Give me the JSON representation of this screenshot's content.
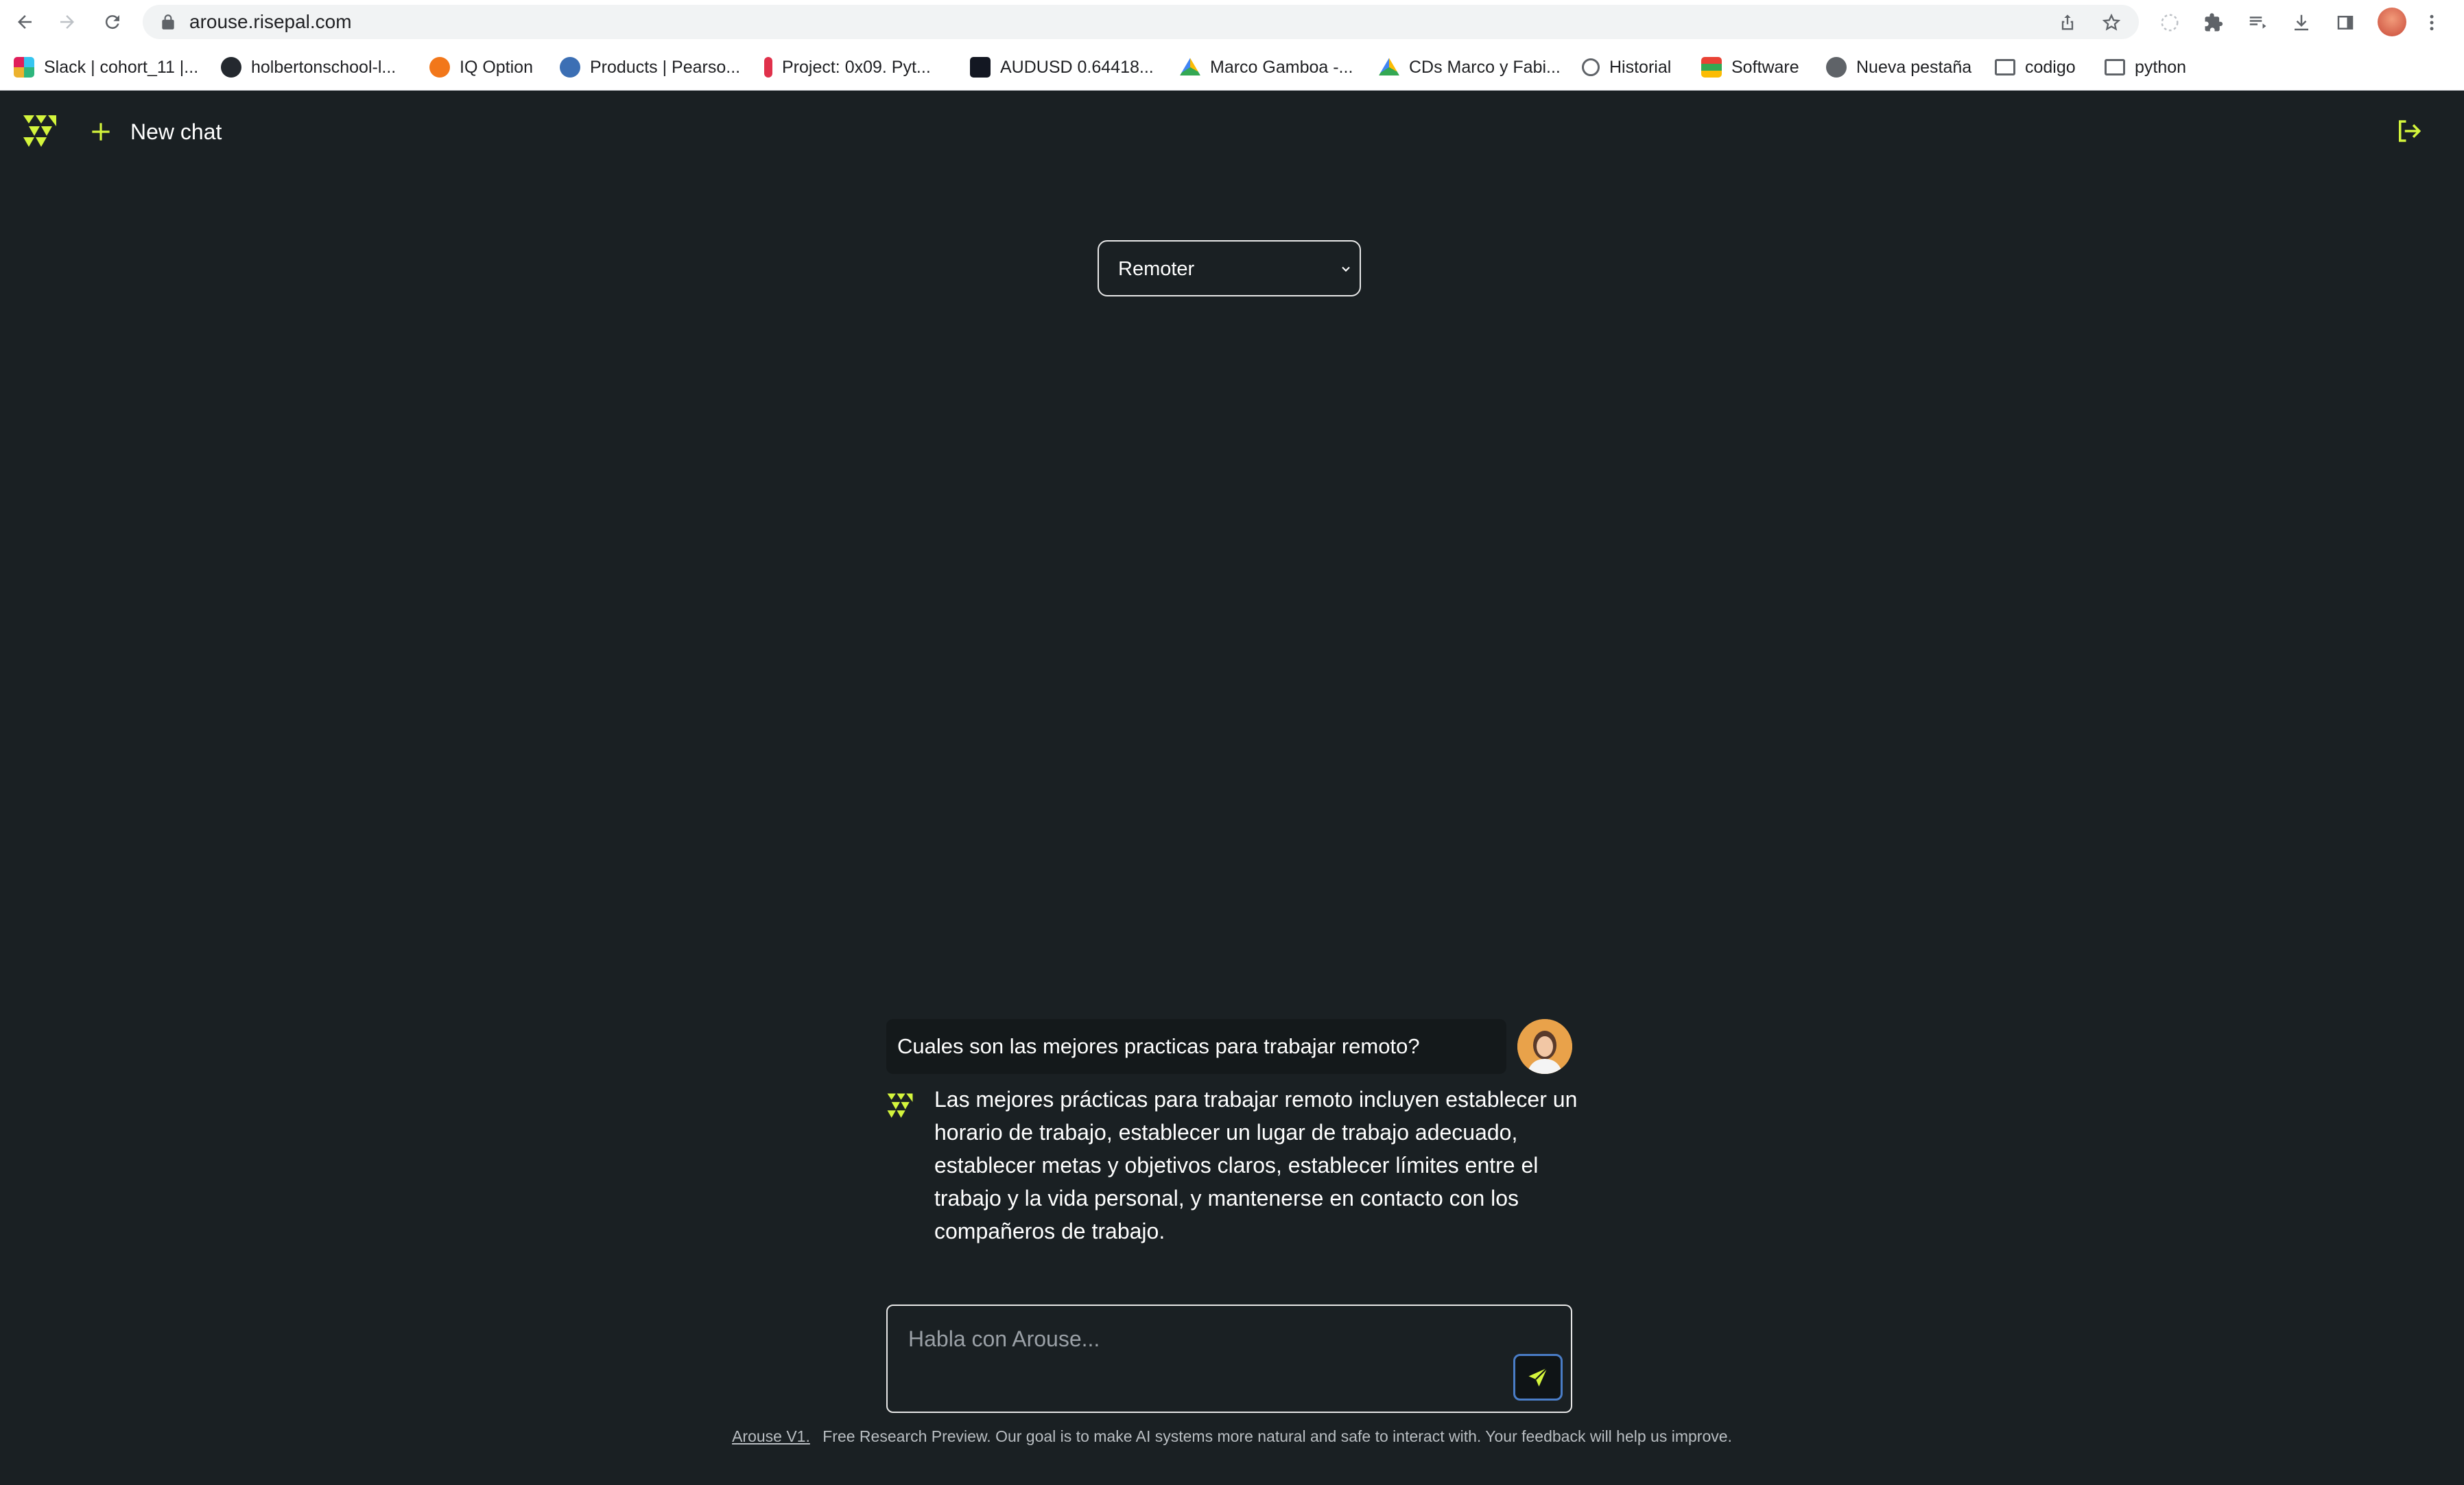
{
  "browser": {
    "url": "arouse.risepal.com",
    "bookmarks": [
      {
        "label": "Slack | cohort_11 |...",
        "icon": "slack-icon"
      },
      {
        "label": "holbertonschool-l...",
        "icon": "github-icon"
      },
      {
        "label": "IQ Option",
        "icon": "iq-option-icon"
      },
      {
        "label": "Products | Pearso...",
        "icon": "pearson-icon"
      },
      {
        "label": "Project: 0x09. Pyt...",
        "icon": "holberton-icon"
      },
      {
        "label": "AUDUSD 0.64418...",
        "icon": "tradingview-icon"
      },
      {
        "label": "Marco Gamboa -...",
        "icon": "google-drive-icon"
      },
      {
        "label": "CDs Marco y Fabi...",
        "icon": "google-drive-icon"
      },
      {
        "label": "Historial",
        "icon": "history-icon"
      },
      {
        "label": "Software",
        "icon": "stack-icon"
      },
      {
        "label": "Nueva pestaña",
        "icon": "globe-icon"
      },
      {
        "label": "codigo",
        "icon": "folder-icon"
      },
      {
        "label": "python",
        "icon": "folder-icon"
      }
    ]
  },
  "app": {
    "new_chat_label": "New chat",
    "model_select": {
      "selected": "Remoter",
      "options": [
        "Remoter"
      ]
    },
    "conversation": {
      "user_message": "Cuales son las mejores practicas para trabajar remoto?",
      "bot_message": "Las mejores prácticas para trabajar remoto incluyen establecer un horario de trabajo, establecer un lugar de trabajo adecuado, establecer metas y objetivos claros, establecer límites entre el trabajo y la vida personal, y mantenerse en contacto con los compañeros de trabajo."
    },
    "composer": {
      "placeholder": "Habla con Arouse..."
    },
    "footer": {
      "link_text": "Arouse V1.",
      "text": "Free Research Preview. Our goal is to make AI systems more natural and safe to interact with. Your feedback will help us improve."
    }
  },
  "colors": {
    "background": "#1a2023",
    "accent": "#d4f53c",
    "send_border": "#4a7dc7"
  }
}
